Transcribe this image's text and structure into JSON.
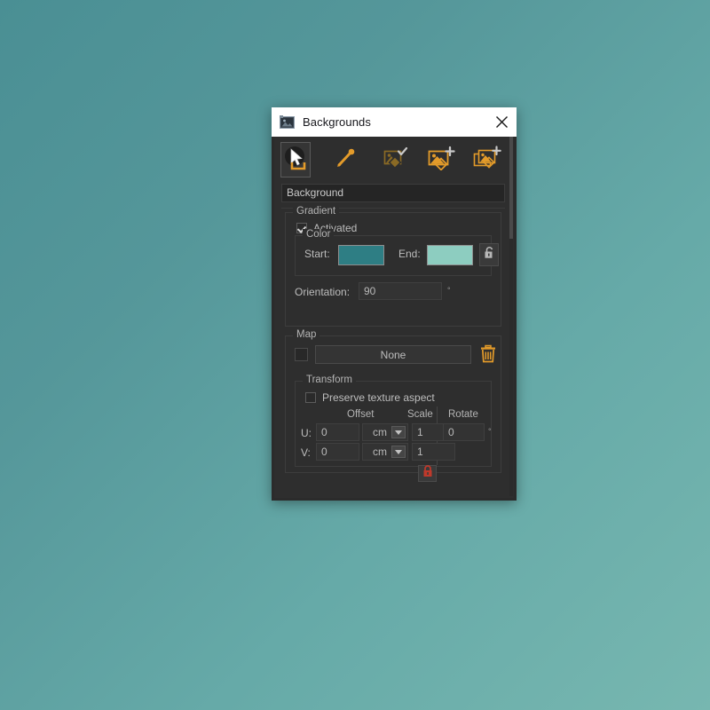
{
  "window": {
    "title": "Backgrounds",
    "icon": "picture-icon",
    "close_label": "✕"
  },
  "toolbar": {
    "items": [
      {
        "name": "select-tool",
        "icon": "cursor-select-icon",
        "selected": true
      },
      {
        "name": "pick-tool",
        "icon": "eyedropper-icon",
        "selected": false
      },
      {
        "name": "apply-background",
        "icon": "image-check-icon",
        "selected": false
      },
      {
        "name": "add-background",
        "icon": "image-plus-icon",
        "selected": false
      },
      {
        "name": "add-multi-background",
        "icon": "images-plus-icon",
        "selected": false
      }
    ]
  },
  "name_field": {
    "value": "Background",
    "placeholder": "Background"
  },
  "gradient": {
    "title": "Gradient",
    "activated_label": "Activated",
    "activated": true,
    "color": {
      "title": "Color",
      "start_label": "Start:",
      "end_label": "End:",
      "start_color": "#2e7e84",
      "end_color": "#8dcdc0",
      "lock_icon": "padlock-open-icon",
      "locked": false
    },
    "orientation_label": "Orientation:",
    "orientation_value": "90",
    "orientation_unit": "°"
  },
  "map": {
    "title": "Map",
    "enabled": false,
    "button_label": "None",
    "delete_icon": "trash-icon",
    "transform": {
      "title": "Transform",
      "preserve_label": "Preserve texture aspect",
      "preserve_checked": false,
      "headers": {
        "offset": "Offset",
        "scale": "Scale",
        "rotate": "Rotate"
      },
      "rows": [
        {
          "axis_label": "U:",
          "offset": "0",
          "unit": "cm",
          "scale": "1",
          "rotate": "0",
          "rotate_unit": "°"
        },
        {
          "axis_label": "V:",
          "offset": "0",
          "unit": "cm",
          "scale": "1"
        }
      ],
      "lock_icon": "padlock-closed-icon",
      "locked": true,
      "lock_color": "#c0392b"
    }
  },
  "theme": {
    "accent": "#e39b2a",
    "panel_bg": "#2e2e2e",
    "desktop_bg_top": "#4a8f94",
    "desktop_bg_bottom": "#77b7b0"
  }
}
